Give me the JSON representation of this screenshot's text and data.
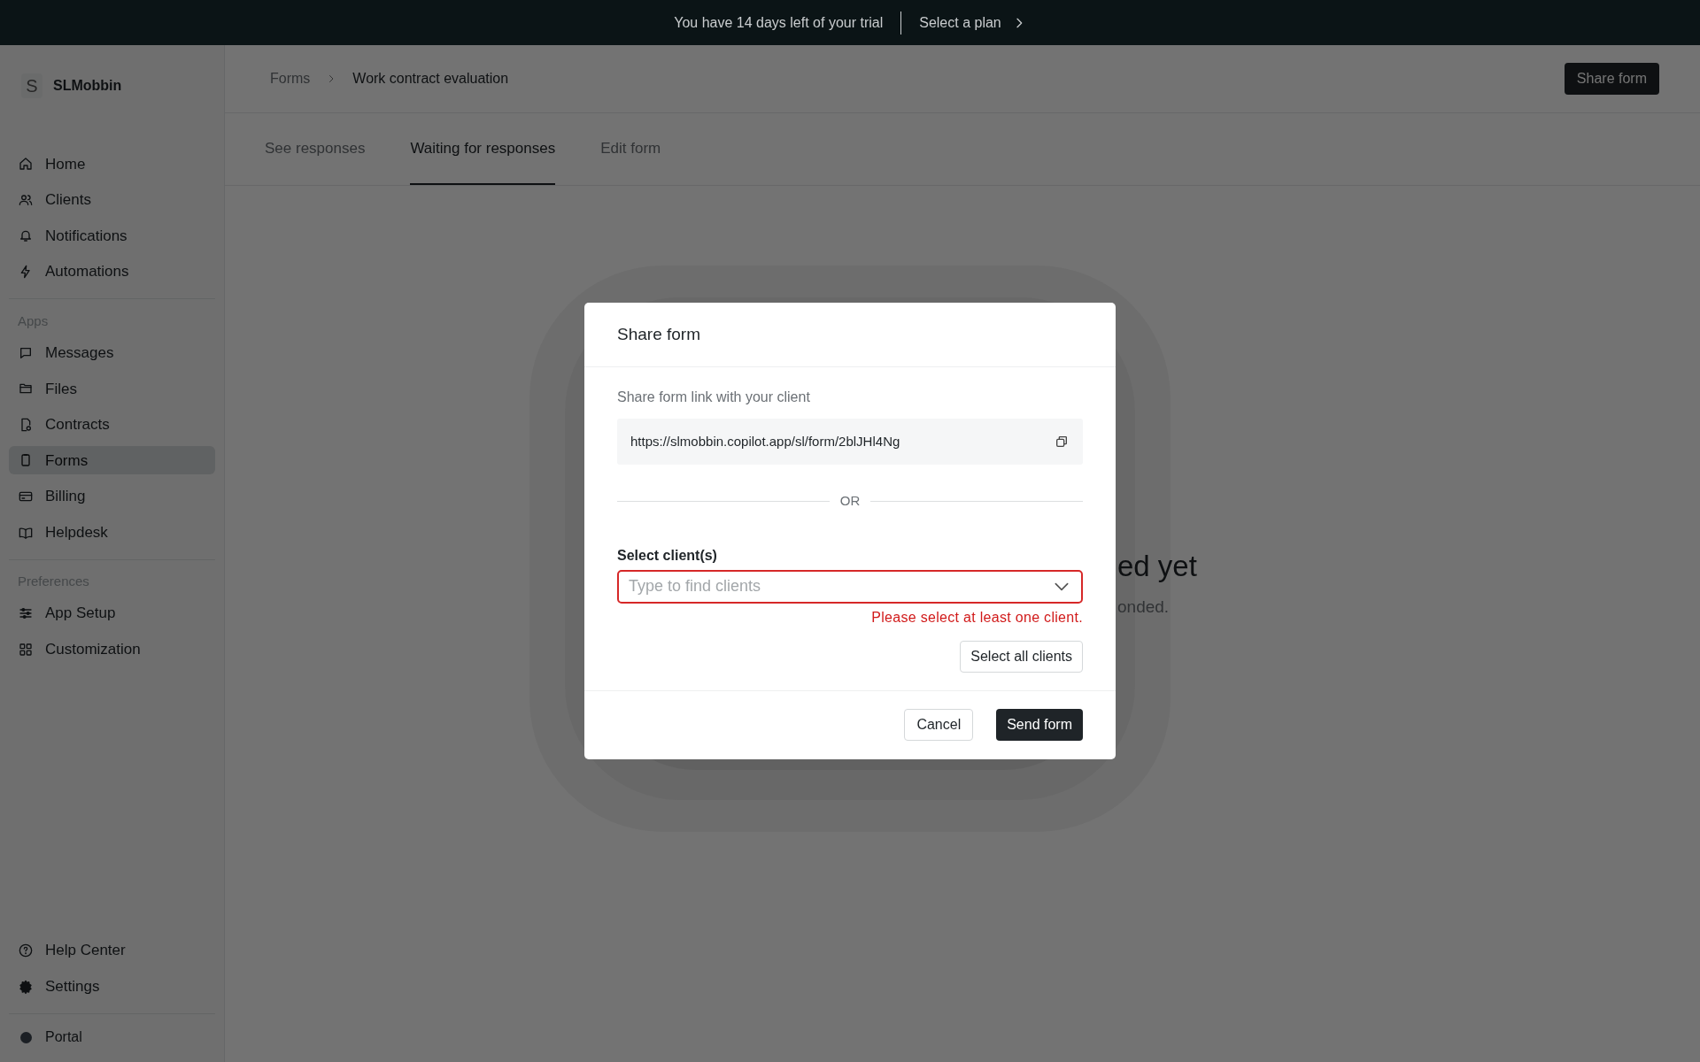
{
  "banner": {
    "text": "You have 14 days left of your trial",
    "link": "Select a plan"
  },
  "sidebar": {
    "brand_initial": "S",
    "brand": "SLMobbin",
    "groups": [
      {
        "items": [
          {
            "label": "Home",
            "selected": false
          },
          {
            "label": "Clients",
            "selected": false
          },
          {
            "label": "Notifications",
            "selected": false
          },
          {
            "label": "Automations",
            "selected": false
          }
        ]
      },
      {
        "heading": "Apps",
        "items": [
          {
            "label": "Messages",
            "selected": false
          },
          {
            "label": "Files",
            "selected": false
          },
          {
            "label": "Contracts",
            "selected": false
          },
          {
            "label": "Forms",
            "selected": true
          },
          {
            "label": "Billing",
            "selected": false
          },
          {
            "label": "Helpdesk",
            "selected": false
          }
        ]
      },
      {
        "heading": "Preferences",
        "items": [
          {
            "label": "App Setup",
            "selected": false
          },
          {
            "label": "Customization",
            "selected": false
          }
        ]
      }
    ],
    "bottom_items": [
      {
        "label": "Help Center"
      },
      {
        "label": "Settings"
      }
    ],
    "portal": "Portal"
  },
  "header": {
    "breadcrumbs": [
      "Forms",
      "Work contract evaluation"
    ],
    "share_button": "Share form"
  },
  "tabs": [
    {
      "label": "See responses",
      "selected": false
    },
    {
      "label": "Waiting for responses",
      "selected": true
    },
    {
      "label": "Edit form",
      "selected": false
    }
  ],
  "empty_state": {
    "title_fragment": "ed yet",
    "text_fragment": "onded."
  },
  "modal": {
    "title": "Share form",
    "link_label": "Share form link with your client",
    "url": "https://slmobbin.copilot.app/sl/form/2blJHl4Ng",
    "divider": "OR",
    "select_label": "Select client(s)",
    "placeholder": "Type to find clients",
    "error": "Please select at least one client.",
    "select_all": "Select all clients",
    "cancel": "Cancel",
    "send": "Send form"
  }
}
